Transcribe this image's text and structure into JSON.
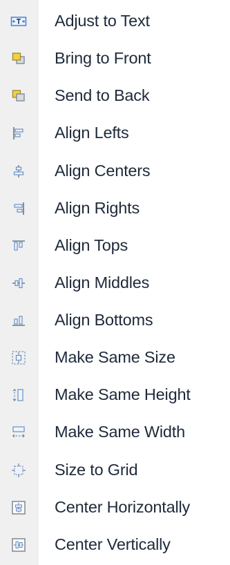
{
  "menu": {
    "items": [
      {
        "label": "Adjust to Text",
        "icon": "adjust-to-text-icon"
      },
      {
        "label": "Bring to Front",
        "icon": "bring-to-front-icon"
      },
      {
        "label": "Send to Back",
        "icon": "send-to-back-icon"
      },
      {
        "label": "Align Lefts",
        "icon": "align-lefts-icon"
      },
      {
        "label": "Align Centers",
        "icon": "align-centers-icon"
      },
      {
        "label": "Align Rights",
        "icon": "align-rights-icon"
      },
      {
        "label": "Align Tops",
        "icon": "align-tops-icon"
      },
      {
        "label": "Align Middles",
        "icon": "align-middles-icon"
      },
      {
        "label": "Align Bottoms",
        "icon": "align-bottoms-icon"
      },
      {
        "label": "Make Same Size",
        "icon": "make-same-size-icon"
      },
      {
        "label": "Make Same Height",
        "icon": "make-same-height-icon"
      },
      {
        "label": "Make Same Width",
        "icon": "make-same-width-icon"
      },
      {
        "label": "Size to Grid",
        "icon": "size-to-grid-icon"
      },
      {
        "label": "Center Horizontally",
        "icon": "center-horizontally-icon"
      },
      {
        "label": "Center Vertically",
        "icon": "center-vertically-icon"
      }
    ]
  },
  "colors": {
    "gutter": "#f0f0f0",
    "text": "#1e2a3a",
    "icon_blue": "#3a7bd5",
    "icon_yellow": "#f5d23c",
    "icon_gray": "#7a8494"
  }
}
